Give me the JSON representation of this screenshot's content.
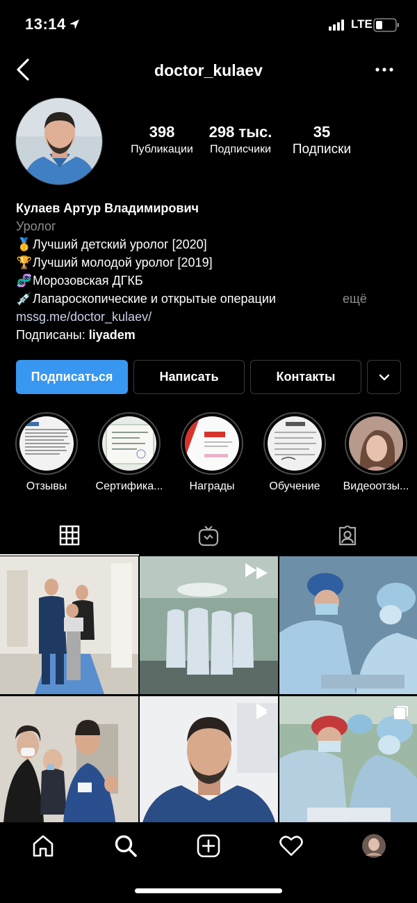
{
  "status": {
    "time": "13:14",
    "network": "LTE"
  },
  "header": {
    "username": "doctor_kulaev"
  },
  "stats": [
    {
      "value": "398",
      "label": "Публикации"
    },
    {
      "value": "298 тыс.",
      "label": "Подписчики"
    },
    {
      "value": "35",
      "label": "Подписки"
    }
  ],
  "bio": {
    "name": "Кулаев Артур Владимирович",
    "category": "Уролог",
    "lines": [
      {
        "emoji": "🥇",
        "text": "Лучший детский уролог [2020]"
      },
      {
        "emoji": "🏆",
        "text": "Лучший молодой уролог [2019]"
      },
      {
        "emoji": "🧬",
        "text": "Морозовская ДГКБ"
      },
      {
        "emoji": "💉",
        "text": "Лапароскопические и открытые операции"
      }
    ],
    "more": "ещё",
    "link": "mssg.me/doctor_kulaev/",
    "followed_by_prefix": "Подписаны: ",
    "followed_by_user": "liyadem"
  },
  "buttons": {
    "follow": "Подписаться",
    "message": "Написать",
    "contacts": "Контакты"
  },
  "highlights": [
    {
      "label": "Отзывы"
    },
    {
      "label": "Сертифика..."
    },
    {
      "label": "Награды"
    },
    {
      "label": "Обучение"
    },
    {
      "label": "Видеоотзы..."
    }
  ],
  "colors": {
    "accent": "#3897f0",
    "link": "#c7d2e7",
    "muted": "#8e8e8e"
  }
}
